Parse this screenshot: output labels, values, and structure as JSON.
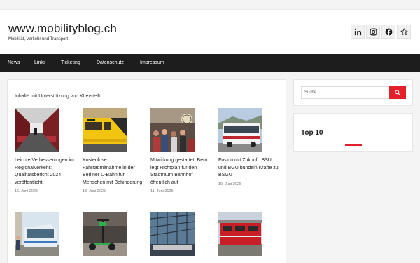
{
  "site": {
    "title": "www.mobilityblog.ch",
    "tagline": "Mobilität, Verkehr und Transport"
  },
  "social": [
    {
      "icon": "linkedin-icon",
      "label": "in"
    },
    {
      "icon": "instagram-icon"
    },
    {
      "icon": "facebook-icon"
    },
    {
      "icon": "star-icon"
    }
  ],
  "nav": {
    "items": [
      "News",
      "Links",
      "Ticketing",
      "Datenschutz",
      "Impressum"
    ],
    "active": "News"
  },
  "main": {
    "heading": "Inhalte mit Unterstützung von KI erstellt",
    "posts": [
      {
        "title": "Leichte Verbesserungen im Regionalverkehr: Qualitätsbericht 2024 veröffentlicht",
        "date": "16. Juni 2025",
        "image": "train-interior"
      },
      {
        "title": "Kostenlose Fahrradmitnahme in der Berliner U-Bahn für Menschen mit Behinderung",
        "date": "13. Juni 2025",
        "image": "u-bahn-yellow"
      },
      {
        "title": "Mitwirkung gestartet: Bern legt Richtplan für den Stadtraum Bahnhof öffentlich auf",
        "date": "11. Juni 2025",
        "image": "station-crowd"
      },
      {
        "title": "Fusion mit Zukunft: BSU und BGU bündeln Kräfte zu BSGU",
        "date": "10. Juni 2025",
        "image": "bus-white"
      },
      {
        "title": "",
        "date": "",
        "image": "tram-city"
      },
      {
        "title": "",
        "date": "",
        "image": "e-scooter"
      },
      {
        "title": "",
        "date": "",
        "image": "station-roof"
      },
      {
        "title": "",
        "date": "",
        "image": "red-locomotive"
      }
    ]
  },
  "sidebar": {
    "search_placeholder": "Suche",
    "top10_title": "Top 10"
  },
  "colors": {
    "accent": "#e3202a",
    "nav_bg": "#1d1d1d"
  }
}
